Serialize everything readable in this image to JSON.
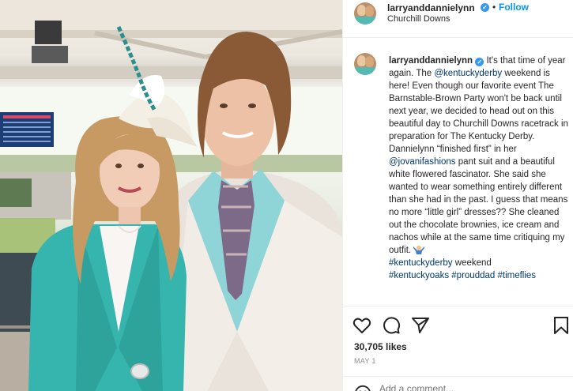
{
  "post": {
    "username": "larryanddannielynn",
    "follow_label": "Follow",
    "separator": "•",
    "location": "Churchill Downs",
    "verified_glyph": "✓"
  },
  "caption": {
    "intro": " It's that time of year again. The ",
    "mention_1": "@kentuckyderby",
    "part_2": " weekend is here! Even though our favorite event The Barnstable-Brown Party won't be back until next year, we decided to head out on this beautiful day to Churchill Downs racetrack in preparation for The Kentucky Derby. Dannielynn “finished first” in her ",
    "mention_2": "@jovanifashions",
    "part_3": " pant suit and a beautiful white flowered fascinator. She said she wanted to wear something entirely different than she had in the past. I guess that means no more “little girl” dresses?? She cleaned out the chocolate brownies, ice cream and nachos while at the same time critiquing my outfit. ",
    "emoji_name": "person-shrugging-emoji",
    "hashtag_1": "#kentuckyderby",
    "part_4": " weekend ",
    "hashtag_2": "#kentuckyoaks",
    "hashtag_3": "#prouddad",
    "hashtag_4": "#timeflies"
  },
  "actions": {
    "likes": "30,705 likes",
    "date": "MAY 1",
    "comment_placeholder": "Add a comment..."
  },
  "icons": {
    "like": "heart-icon",
    "comment": "comment-icon",
    "share": "send-icon",
    "save": "bookmark-icon",
    "emoji": "smiley-icon"
  },
  "colors": {
    "accent": "#0095f6",
    "verified": "#3897f0",
    "link": "#00376b",
    "text": "#262626",
    "muted": "#8e8e8e",
    "border": "#efefef"
  }
}
